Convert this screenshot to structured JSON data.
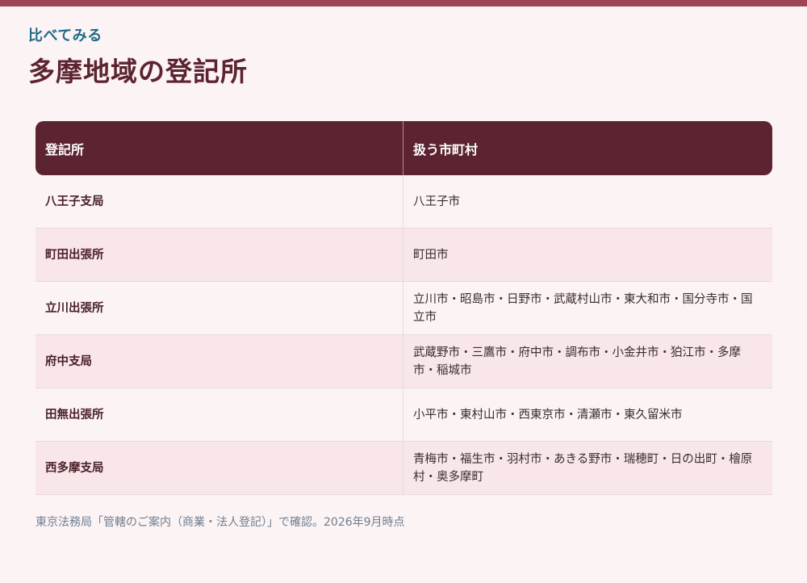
{
  "accent": "#9b4651",
  "eyebrow": "比べてみる",
  "title": "多摩地域の登記所",
  "table": {
    "headers": [
      "登記所",
      "扱う市町村"
    ],
    "rows": [
      [
        "八王子支局",
        "八王子市"
      ],
      [
        "町田出張所",
        "町田市"
      ],
      [
        "立川出張所",
        "立川市・昭島市・日野市・武蔵村山市・東大和市・国分寺市・国立市"
      ],
      [
        "府中支局",
        "武蔵野市・三鷹市・府中市・調布市・小金井市・狛江市・多摩市・稲城市"
      ],
      [
        "田無出張所",
        "小平市・東村山市・西東京市・清瀬市・東久留米市"
      ],
      [
        "西多摩支局",
        "青梅市・福生市・羽村市・あきる野市・瑞穂町・日の出町・檜原村・奥多摩町"
      ]
    ]
  },
  "note": "東京法務局「管轄のご案内（商業・法人登記）」で確認。2026年9月時点"
}
